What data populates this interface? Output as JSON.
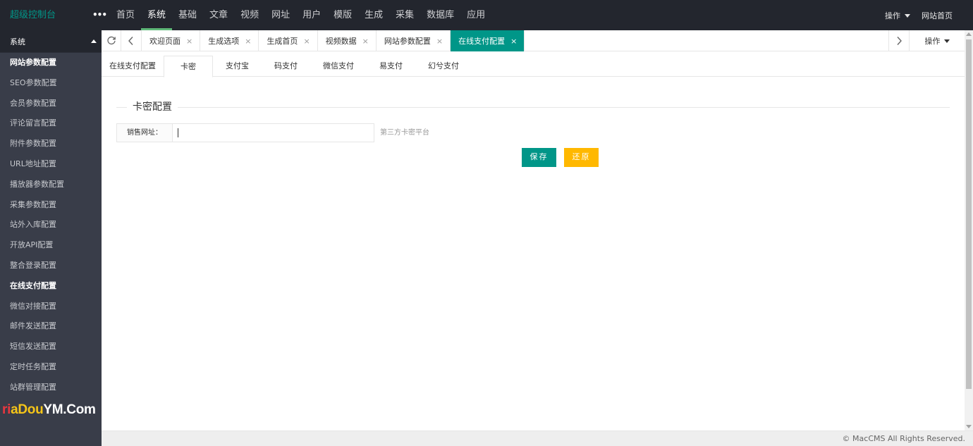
{
  "header": {
    "logo": "超级控制台",
    "more": "•••",
    "nav": [
      {
        "label": "首页",
        "active": false
      },
      {
        "label": "系统",
        "active": true
      },
      {
        "label": "基础",
        "active": false
      },
      {
        "label": "文章",
        "active": false
      },
      {
        "label": "视频",
        "active": false
      },
      {
        "label": "网址",
        "active": false
      },
      {
        "label": "用户",
        "active": false
      },
      {
        "label": "模版",
        "active": false
      },
      {
        "label": "生成",
        "active": false
      },
      {
        "label": "采集",
        "active": false
      },
      {
        "label": "数据库",
        "active": false
      },
      {
        "label": "应用",
        "active": false
      }
    ],
    "operate": "操作",
    "site_home": "网站首页"
  },
  "sidebar": {
    "group": "系统",
    "items": [
      {
        "label": "网站参数配置",
        "bold": true
      },
      {
        "label": "SEO参数配置",
        "bold": false
      },
      {
        "label": "会员参数配置",
        "bold": false
      },
      {
        "label": "评论留言配置",
        "bold": false
      },
      {
        "label": "附件参数配置",
        "bold": false
      },
      {
        "label": "URL地址配置",
        "bold": false
      },
      {
        "label": "播放器参数配置",
        "bold": false
      },
      {
        "label": "采集参数配置",
        "bold": false
      },
      {
        "label": "站外入库配置",
        "bold": false
      },
      {
        "label": "开放API配置",
        "bold": false
      },
      {
        "label": "整合登录配置",
        "bold": false
      },
      {
        "label": "在线支付配置",
        "bold": true
      },
      {
        "label": "微信对接配置",
        "bold": false
      },
      {
        "label": "邮件发送配置",
        "bold": false
      },
      {
        "label": "短信发送配置",
        "bold": false
      },
      {
        "label": "定时任务配置",
        "bold": false
      },
      {
        "label": "站群管理配置",
        "bold": false
      }
    ],
    "watermark": {
      "a": "i",
      "b": "aDou",
      "c": "YM.Com",
      "prefix": "r"
    }
  },
  "tabbar": {
    "tabs": [
      {
        "label": "欢迎页面",
        "active": false
      },
      {
        "label": "生成选项",
        "active": false
      },
      {
        "label": "生成首页",
        "active": false
      },
      {
        "label": "视频数据",
        "active": false
      },
      {
        "label": "网站参数配置",
        "active": false
      },
      {
        "label": "在线支付配置",
        "active": true
      }
    ],
    "close": "×",
    "operate": "操作"
  },
  "subtabs": [
    {
      "label": "在线支付配置",
      "active": false
    },
    {
      "label": "卡密",
      "active": true
    },
    {
      "label": "支付宝",
      "active": false
    },
    {
      "label": "码支付",
      "active": false
    },
    {
      "label": "微信支付",
      "active": false
    },
    {
      "label": "易支付",
      "active": false
    },
    {
      "label": "幻兮支付",
      "active": false
    }
  ],
  "form": {
    "legend": "卡密配置",
    "label": "销售网址：",
    "value": "",
    "placeholder": "",
    "aux": "第三方卡密平台",
    "save": "保存",
    "reset": "还原"
  },
  "footer": {
    "copyright": "© MacCMS All Rights Reserved."
  }
}
